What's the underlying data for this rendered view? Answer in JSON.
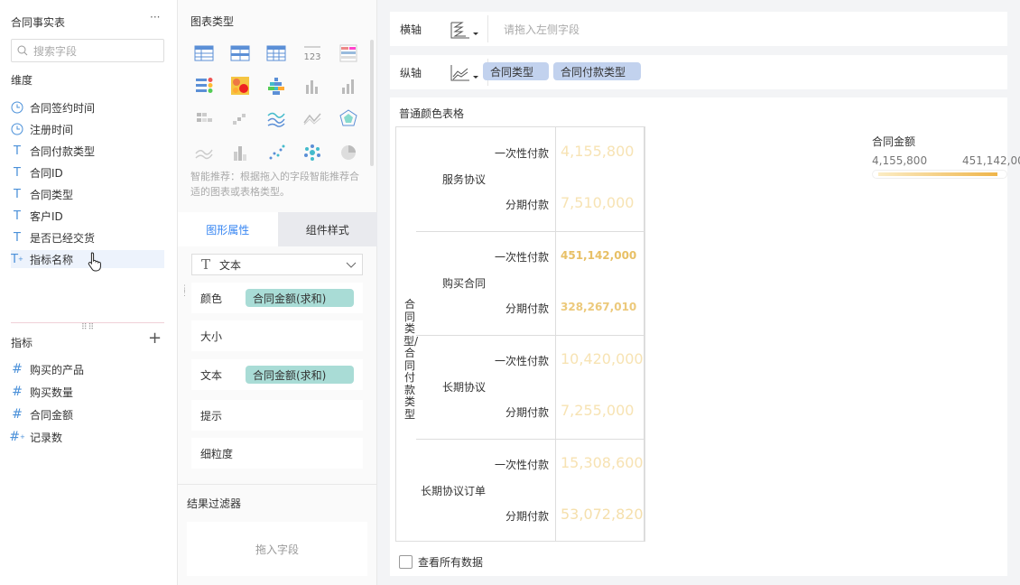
{
  "left": {
    "title": "合同事实表",
    "more": "···",
    "search_placeholder": "搜索字段",
    "dim_title": "维度",
    "dims": [
      "合同签约时间",
      "注册时间",
      "合同付款类型",
      "合同ID",
      "合同类型",
      "客户ID",
      "是否已经交货",
      "指标名称"
    ],
    "measure_title": "指标",
    "add": "+",
    "measures": [
      "购买的产品",
      "购买数量",
      "合同金额",
      "记录数"
    ]
  },
  "mid": {
    "chart_type_title": "图表类型",
    "tip": "智能推荐：根据拖入的字段智能推荐合适的图表或表格类型。",
    "tabs": [
      "图形属性",
      "组件样式"
    ],
    "dropdown": "文本",
    "props": {
      "color": "颜色",
      "size": "大小",
      "text": "文本",
      "hint": "提示",
      "granularity": "细粒度",
      "color_field": "合同金额(求和)",
      "text_field": "合同金额(求和)"
    },
    "filter_title": "结果过滤器",
    "filter_drop": "拖入字段"
  },
  "right": {
    "x_axis": "横轴",
    "x_placeholder": "请拖入左侧字段",
    "y_axis": "纵轴",
    "y_fields": [
      "合同类型",
      "合同付款类型"
    ],
    "panel_title": "普通颜色表格",
    "row_header": "合同类型/合同付款类型",
    "groups": [
      {
        "name": "服务协议",
        "rows": [
          {
            "pay": "一次性付款",
            "value": "4,155,800",
            "frac": 0.0
          },
          {
            "pay": "分期付款",
            "value": "7,510,000",
            "frac": 0.008
          }
        ]
      },
      {
        "name": "购买合同",
        "rows": [
          {
            "pay": "一次性付款",
            "value": "451,142,000",
            "frac": 1.0
          },
          {
            "pay": "分期付款",
            "value": "328,267,010",
            "frac": 0.73
          }
        ]
      },
      {
        "name": "长期协议",
        "rows": [
          {
            "pay": "一次性付款",
            "value": "10,420,000",
            "frac": 0.014
          },
          {
            "pay": "分期付款",
            "value": "7,255,000",
            "frac": 0.007
          }
        ]
      },
      {
        "name": "长期协议订单",
        "rows": [
          {
            "pay": "一次性付款",
            "value": "15,308,600",
            "frac": 0.025
          },
          {
            "pay": "分期付款",
            "value": "53,072,820",
            "frac": 0.11
          }
        ]
      }
    ],
    "legend": {
      "title": "合同金额",
      "min": "4,155,800",
      "max": "451,142,000"
    },
    "view_all": "查看所有数据"
  },
  "colors": {
    "accent": "#3685f2",
    "light_val": "#f7e3b4",
    "dark_val": "#e8c066",
    "gradient_start": "#fbecc4",
    "gradient_end": "#efb54a"
  }
}
